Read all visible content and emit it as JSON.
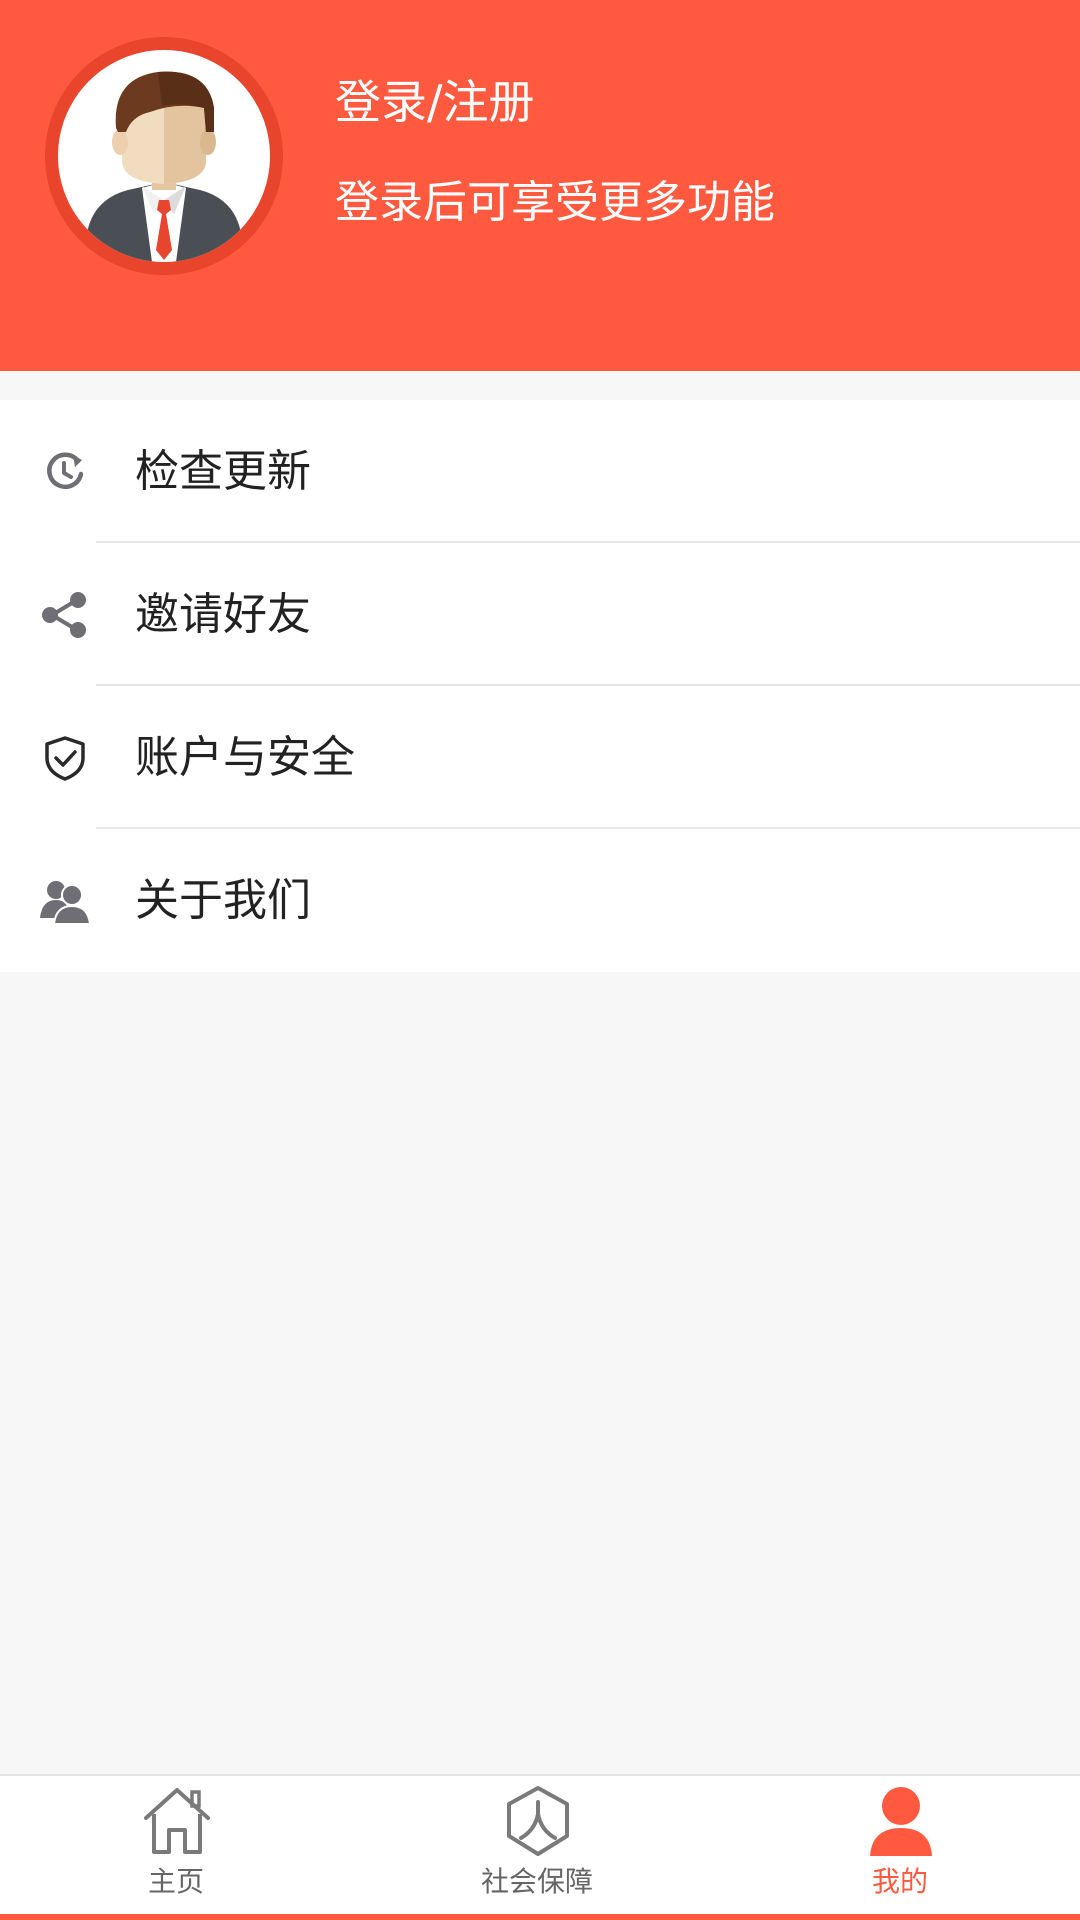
{
  "colors": {
    "brand": "#ff5a40",
    "avatar_ring": "#e9442c",
    "background": "#f7f7f7",
    "icon_gray": "#6e6e74",
    "text": "#222222"
  },
  "header": {
    "avatar_icon": "user-avatar-icon",
    "login_title": "登录/注册",
    "login_subtitle": "登录后可享受更多功能"
  },
  "menu": {
    "items": [
      {
        "label": "检查更新",
        "icon": "refresh-clock-icon"
      },
      {
        "label": "邀请好友",
        "icon": "share-icon"
      },
      {
        "label": "账户与安全",
        "icon": "shield-check-icon"
      },
      {
        "label": "关于我们",
        "icon": "people-icon"
      }
    ]
  },
  "tabbar": {
    "active_tab": "我的",
    "tabs": [
      {
        "label": "主页",
        "icon": "home-icon"
      },
      {
        "label": "社会保障",
        "icon": "social-security-icon"
      },
      {
        "label": "我的",
        "icon": "profile-icon"
      }
    ]
  }
}
